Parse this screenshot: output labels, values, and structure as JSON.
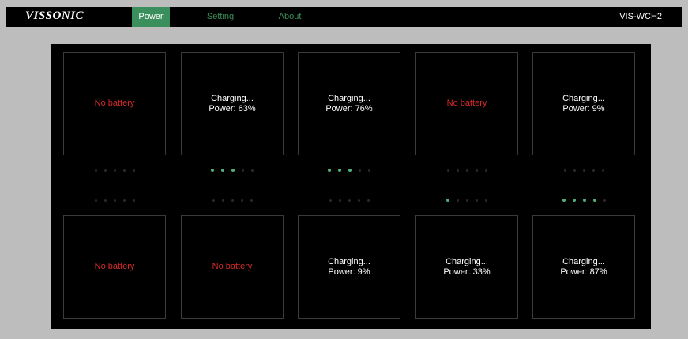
{
  "header": {
    "logo": "VISSONIC",
    "tabs": [
      {
        "label": "Power",
        "active": true
      },
      {
        "label": "Setting",
        "active": false
      },
      {
        "label": "About",
        "active": false
      }
    ],
    "model": "VIS-WCH2"
  },
  "colors": {
    "accent": "#3b8f5c",
    "dot_on": "#4fb07a",
    "dot_off": "#2a2a2a",
    "no_battery": "#d62a2a",
    "panel_bg": "#000000",
    "page_bg": "#bdbdbd"
  },
  "top_row": [
    {
      "status": "No battery",
      "power": "",
      "charging": false,
      "level": 0
    },
    {
      "status": "Charging...",
      "power": "Power:  63%",
      "charging": true,
      "level": 3
    },
    {
      "status": "Charging...",
      "power": "Power:  76%",
      "charging": true,
      "level": 3
    },
    {
      "status": "No battery",
      "power": "",
      "charging": false,
      "level": 0
    },
    {
      "status": "Charging...",
      "power": "Power:  9%",
      "charging": true,
      "level": 0
    }
  ],
  "bottom_row": [
    {
      "status": "No battery",
      "power": "",
      "charging": false,
      "level": 0
    },
    {
      "status": "No battery",
      "power": "",
      "charging": false,
      "level": 0
    },
    {
      "status": "Charging...",
      "power": "Power:  9%",
      "charging": true,
      "level": 0
    },
    {
      "status": "Charging...",
      "power": "Power:  33%",
      "charging": true,
      "level": 1
    },
    {
      "status": "Charging...",
      "power": "Power:  87%",
      "charging": true,
      "level": 4
    }
  ]
}
